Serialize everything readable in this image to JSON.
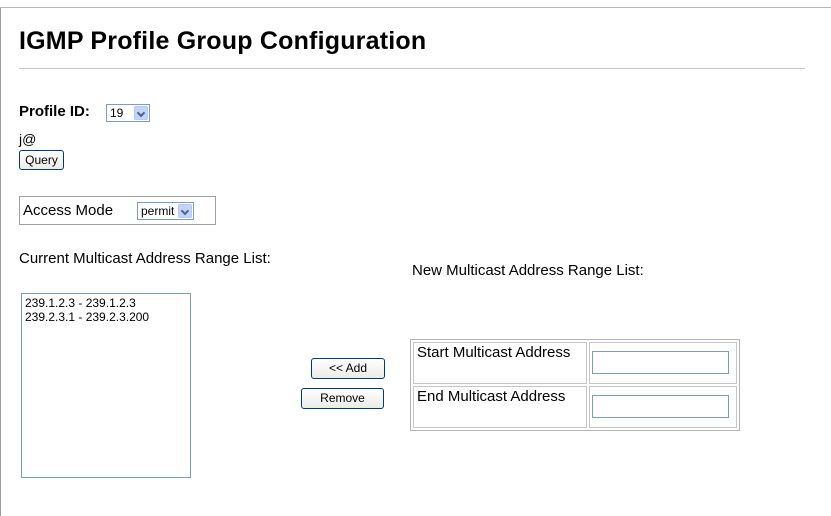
{
  "page": {
    "title": "IGMP Profile Group Configuration"
  },
  "profile": {
    "label": "Profile ID:",
    "value": "19",
    "extra_text": "j@",
    "query_button": "Query"
  },
  "access": {
    "label": "Access Mode",
    "value": "permit"
  },
  "current_list": {
    "label": "Current Multicast Address Range List:",
    "items": [
      "239.1.2.3 - 239.1.2.3",
      "239.2.3.1 - 239.2.3.200"
    ]
  },
  "actions": {
    "add_label": "<< Add",
    "remove_label": "Remove"
  },
  "new_list": {
    "label": "New Multicast Address Range List:",
    "start_label": "Start Multicast Address",
    "end_label": "End Multicast Address",
    "start_value": "",
    "end_value": ""
  },
  "colors": {
    "input_border": "#7f9db9",
    "button_border": "#003c74",
    "dropdown_arrow_bg": "#c3d3fd"
  }
}
